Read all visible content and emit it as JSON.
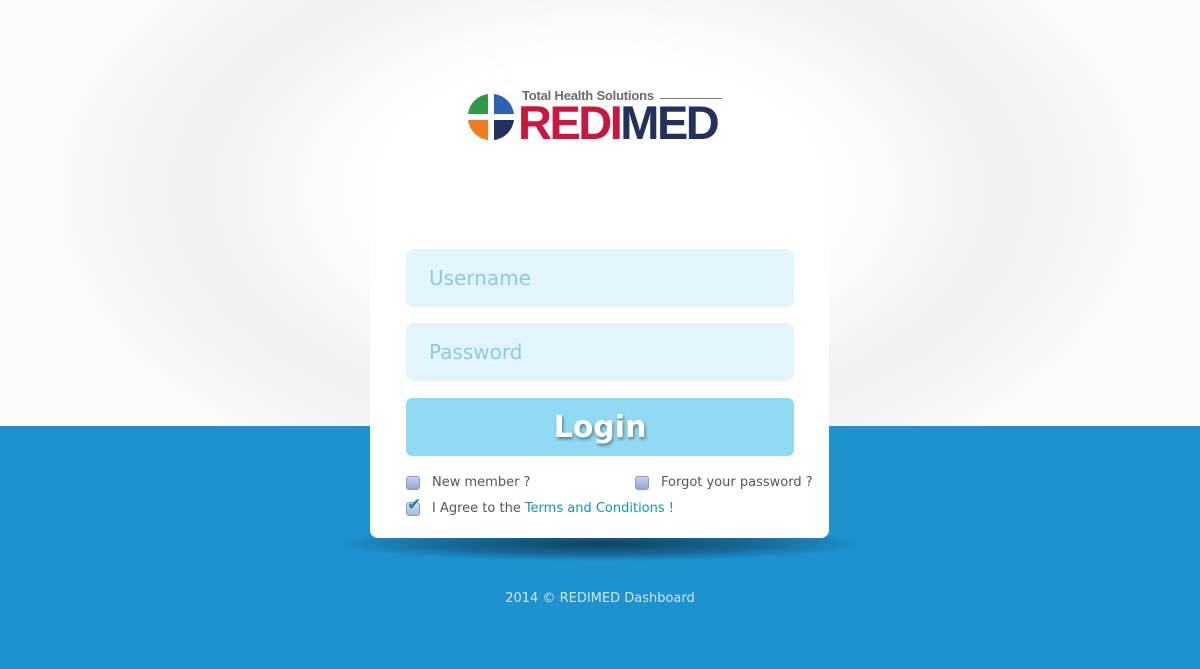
{
  "brand": {
    "tagline": "Total Health Solutions",
    "name_red": "REDI",
    "name_navy": "MED",
    "colors": {
      "red": "#c8183f",
      "navy": "#24305e",
      "green": "#2f9a4a",
      "blue": "#2b62b5",
      "orange": "#f07c22"
    }
  },
  "login_form": {
    "username_placeholder": "Username",
    "password_placeholder": "Password",
    "submit_label": "Login"
  },
  "options": {
    "new_member_label": "New member ?",
    "new_member_checked": false,
    "forgot_password_label": "Forgot your password ?",
    "forgot_password_checked": false,
    "agree_prefix": "I Agree to the",
    "terms_link_label": "Terms and Conditions !",
    "agree_checked": true,
    "checkmark_icon": "checkmark-icon"
  },
  "footer": {
    "text": "2014 © REDIMED Dashboard"
  },
  "colors": {
    "accent_blue": "#1e91cf",
    "input_background": "#e3f5fc",
    "button_background": "#91daf3",
    "link": "#1592b8"
  }
}
